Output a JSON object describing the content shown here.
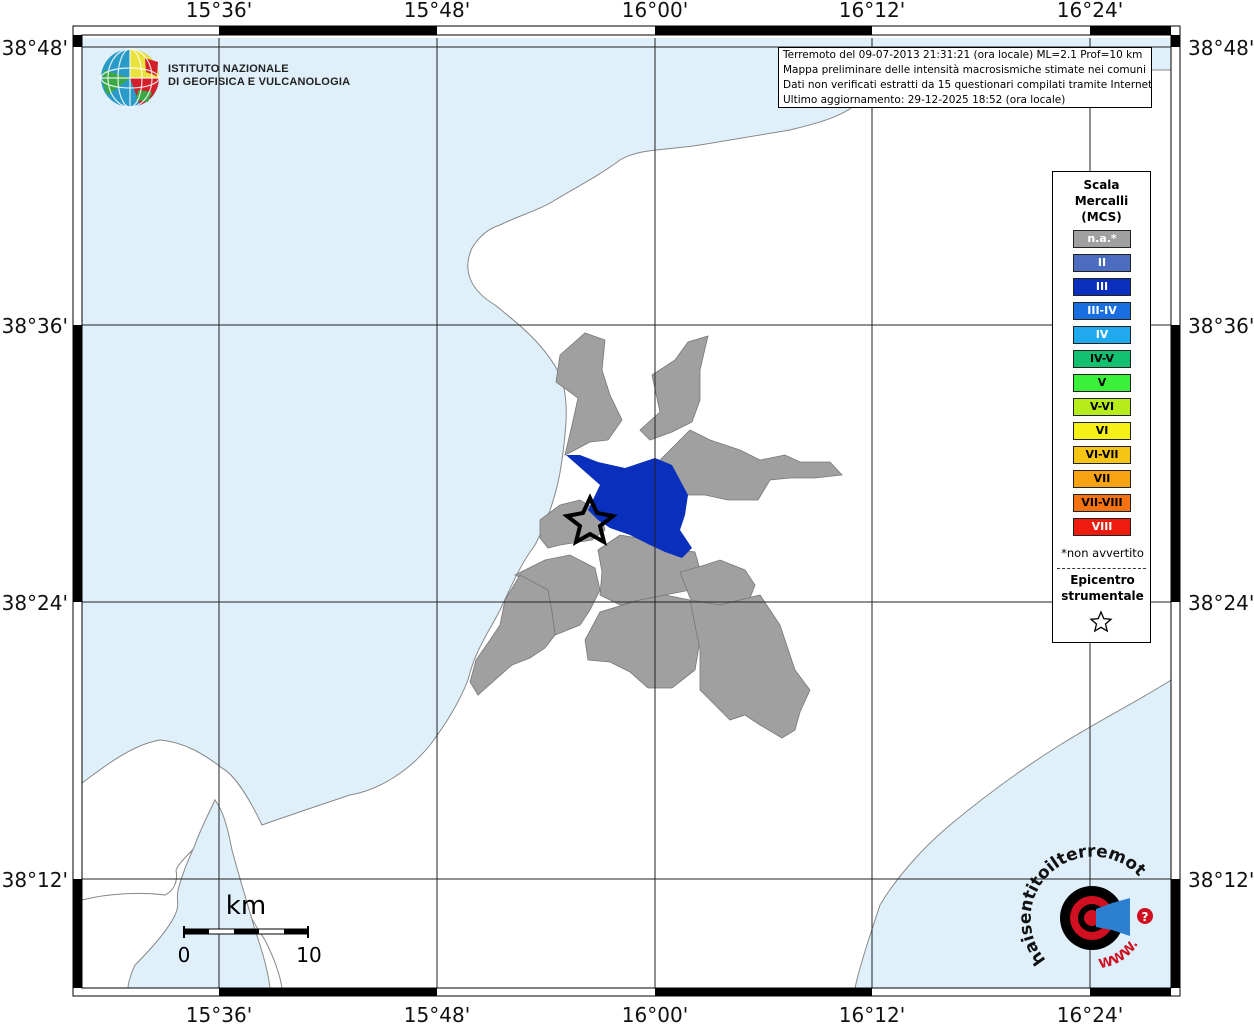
{
  "map": {
    "longitude_labels": [
      "15°36'",
      "15°48'",
      "16°00'",
      "16°12'",
      "16°24'"
    ],
    "latitude_labels": [
      "38°48'",
      "38°36'",
      "38°24'",
      "38°12'"
    ],
    "colors": {
      "sea": "#dff0fb",
      "land": "#ffffff",
      "coast": "#888888",
      "not_felt": "#a0a0a0",
      "intensity_III": "#0a2fbd",
      "grid": "#222222"
    }
  },
  "institute": {
    "name_line1": "ISTITUTO NAZIONALE",
    "name_line2": "DI GEOFISICA E VULCANOLOGIA",
    "logo": "ingv-globe-logo"
  },
  "info": {
    "line1": "Terremoto del 09-07-2013 21:31:21 (ora locale) ML=2.1 Prof=10 km",
    "line2": "Mappa preliminare delle intensità macrosismiche stimate nei comuni",
    "line3": "Dati non verificati estratti da 15 questionari compilati tramite Internet.",
    "line4": "Ultimo aggiornamento: 29-12-2025 18:52 (ora locale)"
  },
  "legend": {
    "title_line1": "Scala",
    "title_line2": "Mercalli",
    "title_line3": "(MCS)",
    "items": [
      {
        "label": "n.a.*",
        "color": "#a0a0a0",
        "text_color": "#ffffff"
      },
      {
        "label": "II",
        "color": "#4b6cbf",
        "text_color": "#ffffff"
      },
      {
        "label": "III",
        "color": "#0a2fbd",
        "text_color": "#ffffff"
      },
      {
        "label": "III-IV",
        "color": "#1a6fe0",
        "text_color": "#ffffff"
      },
      {
        "label": "IV",
        "color": "#21a9f0",
        "text_color": "#ffffff"
      },
      {
        "label": "IV-V",
        "color": "#12c070",
        "text_color": "#000000"
      },
      {
        "label": "V",
        "color": "#3af03a",
        "text_color": "#000000"
      },
      {
        "label": "V-VI",
        "color": "#b6ec1c",
        "text_color": "#000000"
      },
      {
        "label": "VI",
        "color": "#f5f017",
        "text_color": "#000000"
      },
      {
        "label": "VI-VII",
        "color": "#f5c516",
        "text_color": "#000000"
      },
      {
        "label": "VII",
        "color": "#f7a313",
        "text_color": "#000000"
      },
      {
        "label": "VII-VIII",
        "color": "#f57212",
        "text_color": "#000000"
      },
      {
        "label": "VIII",
        "color": "#ee1c0e",
        "text_color": "#ffffff"
      }
    ],
    "not_felt_note": "*non avvertito",
    "epicenter_line1": "Epicentro",
    "epicenter_line2": "strumentale",
    "epicenter_icon": "star-icon"
  },
  "scale_bar": {
    "unit": "km",
    "min_label": "0",
    "max_label": "10"
  },
  "hst_logo": {
    "text": "haisentitoilterremoto.it",
    "www": "WWW.",
    "question": "?",
    "icon": "megaphone-target-icon"
  }
}
